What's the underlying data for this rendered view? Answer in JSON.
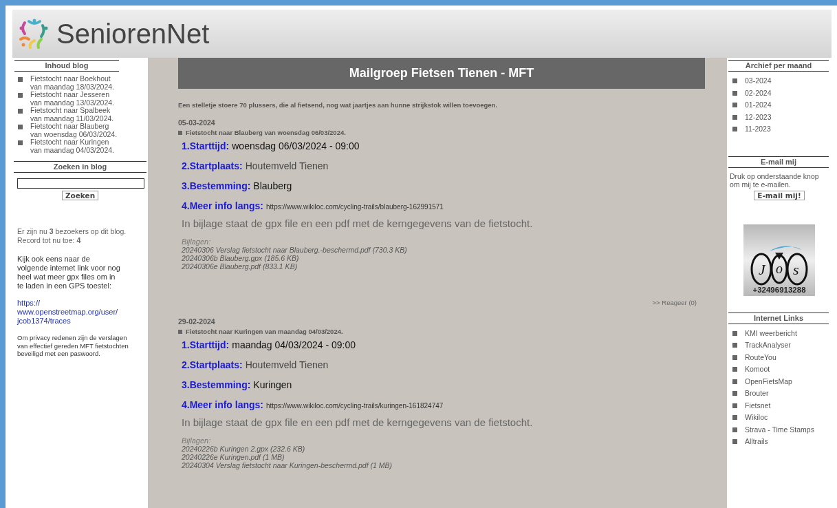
{
  "header": {
    "site_name": "SeniorenNet"
  },
  "left_sidebar": {
    "blog_contents": {
      "title": "Inhoud blog",
      "items": [
        "Fietstocht naar Boekhout van maandag 18/03/2024.",
        "Fietstocht naar Jesseren van maandag 13/03/2024.",
        "Fietstocht naar Spalbeek van maandag 11/03/2024.",
        "Fietstocht naar Blauberg van woensdag 06/03/2024.",
        "Fietstocht naar Kuringen van maandag 04/03/2024."
      ]
    },
    "search": {
      "title": "Zoeken in blog",
      "button": "Zoeken"
    },
    "visitors": [
      "Er zijn nu **3** bezoekers op dit blog.",
      "Record tot nu toe: **4**"
    ],
    "note": "Kijk ook eens naar de volgende internet link voor nog heel wat meer gpx files om in te laden in een GPS toestel:",
    "link": "https:// www.openstreetmap.org/user/ jcob1374/traces",
    "privacy": "Om privacy redenen zijn de verslagen van effectief gereden MFT fietstochten beveiligd met een paswoord."
  },
  "main": {
    "title": "Mailgroep Fietsen Tienen - MFT",
    "intro": "Een stelletje stoere 70 plussers, die al fietsend, nog wat jaartjes aan hunne strijkstok willen toevoegen.",
    "posts": [
      {
        "date": "05-03-2024",
        "subject": "Fietstocht naar Blauberg van woensdag 06/03/2024.",
        "fields": [
          {
            "label": "1.Starttijd:",
            "value": "woensdag 06/03/2024 - 09:00",
            "kind": "text"
          },
          {
            "label": "2.Startplaats:",
            "value": "Houtemveld Tienen",
            "kind": "place"
          },
          {
            "label": "3.Bestemming:",
            "value": "Blauberg",
            "kind": "text"
          },
          {
            "label": "4.Meer info langs:",
            "value": "https://www.wikiloc.com/cycling-trails/blauberg-162991571",
            "kind": "link"
          }
        ],
        "description": "In bijlage staat de gpx file en een pdf met de kerngegevens van de fietstocht.",
        "attachments_label": "Bijlagen:",
        "attachments": [
          "20240306 Verslag fietstocht naar Blauberg.-beschermd.pdf (730.3 KB)",
          "20240306b Blauberg.gpx (185.6 KB)",
          "20240306e Blauberg.pdf (833.1 KB)"
        ],
        "reply": ">> Reageer (0)"
      },
      {
        "date": "29-02-2024",
        "subject": "Fietstocht naar Kuringen van maandag 04/03/2024.",
        "fields": [
          {
            "label": "1.Starttijd:",
            "value": "maandag 04/03/2024 - 09:00",
            "kind": "text"
          },
          {
            "label": "2.Startplaats:",
            "value": "Houtemveld Tienen",
            "kind": "place"
          },
          {
            "label": "3.Bestemming:",
            "value": "Kuringen",
            "kind": "text"
          },
          {
            "label": "4.Meer info langs:",
            "value": "https://www.wikiloc.com/cycling-trails/kuringen-161824747",
            "kind": "link"
          }
        ],
        "description": "In bijlage staat de gpx file en een pdf met de kerngegevens van de fietstocht.",
        "attachments_label": "Bijlagen:",
        "attachments": [
          "20240226b Kuringen 2.gpx (232.6 KB)",
          "20240226e Kuringen.pdf (1 MB)",
          "20240304 Verslag fietstocht naar Kuringen-beschermd.pdf (1 MB)"
        ]
      }
    ]
  },
  "right_sidebar": {
    "archive": {
      "title": "Archief per maand",
      "items": [
        "03-2024",
        "02-2024",
        "01-2024",
        "12-2023",
        "11-2023"
      ]
    },
    "email": {
      "title": "E-mail mij",
      "text": "Druk op onderstaande knop om mij te e-mailen.",
      "button": "E-mail mij!"
    },
    "logo": {
      "letters": [
        "J",
        "o",
        "s"
      ],
      "phone": "+32496913288"
    },
    "links": {
      "title": "Internet Links",
      "items": [
        "KMI weerbericht",
        "TrackAnalyser",
        "RouteYou",
        "Komoot",
        "OpenFietsMap",
        "Brouter",
        "Fietsnet",
        "Wikiloc",
        "Strava - Time Stamps",
        "Alltrails"
      ]
    }
  }
}
